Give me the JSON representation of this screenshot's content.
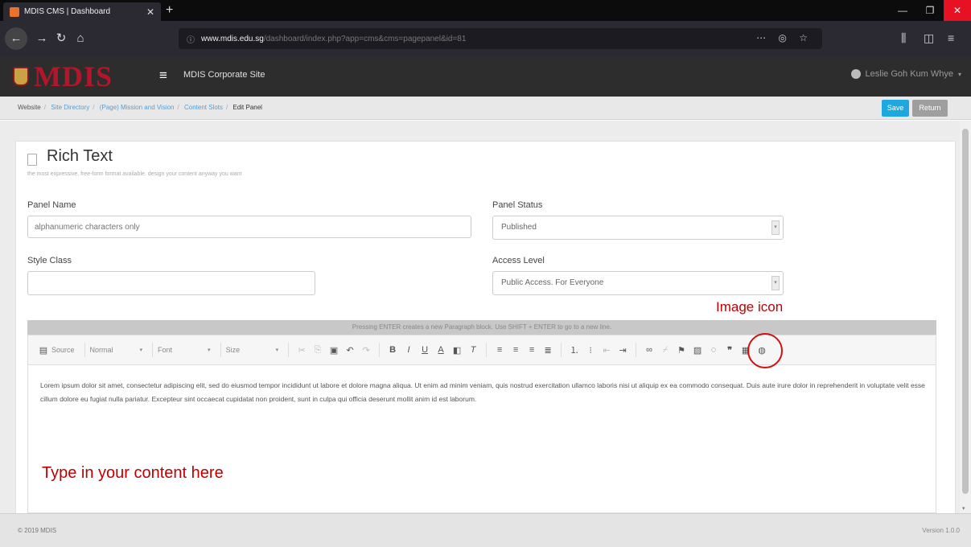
{
  "browser": {
    "tab_title": "MDIS CMS | Dashboard",
    "tab_close": "✕",
    "new_tab": "+",
    "url_host": "www.mdis.edu.sg",
    "url_path": "/dashboard/index.php?app=cms&cms=pagepanel&id=81",
    "window_controls": [
      "—",
      "❐",
      "✕"
    ]
  },
  "header": {
    "logo_text": "MDIS",
    "site_title": "MDIS Corporate Site",
    "user_name": "Leslie Goh Kum Whye"
  },
  "breadcrumb": {
    "items": [
      "Website",
      "Site Directory",
      "(Page) Mission and Vision",
      "Content Slots"
    ],
    "current": "Edit Panel"
  },
  "actions": {
    "save": "Save",
    "return": "Return"
  },
  "form": {
    "title": "Rich Text",
    "subtitle": "the most expressive, free-form format available. design your content anyway you want",
    "panel_name_label": "Panel Name",
    "panel_name_placeholder": "alphanumeric characters only",
    "style_class_label": "Style Class",
    "panel_status_label": "Panel Status",
    "panel_status_value": "Published",
    "access_level_label": "Access Level",
    "access_level_value": "Public Access. For Everyone"
  },
  "editor": {
    "hint": "Pressing ENTER creates a new Paragraph block. Use SHIFT + ENTER to go to a new line.",
    "source": "Source",
    "format": "Normal",
    "font": "Font",
    "size": "Size",
    "body_text": "Lorem ipsum dolor sit amet, consectetur adipiscing elit, sed do eiusmod tempor incididunt ut labore et dolore magna aliqua. Ut enim ad minim veniam, quis nostrud exercitation ullamco laboris nisi ut aliquip ex ea commodo consequat. Duis aute irure dolor in reprehenderit in voluptate velit esse cillum dolore eu fugiat nulla pariatur. Excepteur sint occaecat cupidatat non proident, sunt in culpa qui officia deserunt mollit anim id est laborum."
  },
  "annotations": {
    "image_icon": "Image icon",
    "content_hint": "Type in your content here"
  },
  "footer": {
    "copyright": "© 2019 MDIS",
    "version": "Version 1.0.0"
  }
}
